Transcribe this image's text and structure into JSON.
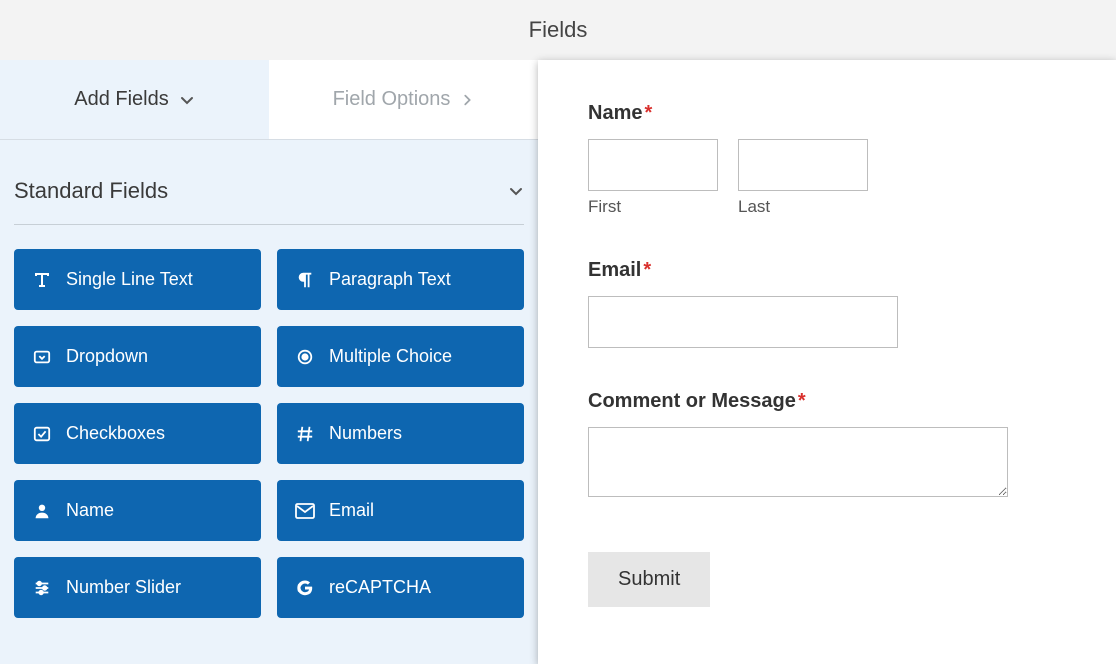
{
  "header": {
    "title": "Fields"
  },
  "tabs": {
    "add": "Add Fields",
    "options": "Field Options"
  },
  "section": {
    "title": "Standard Fields",
    "fields": [
      {
        "label": "Single Line Text",
        "icon": "text"
      },
      {
        "label": "Paragraph Text",
        "icon": "paragraph"
      },
      {
        "label": "Dropdown",
        "icon": "dropdown"
      },
      {
        "label": "Multiple Choice",
        "icon": "radio"
      },
      {
        "label": "Checkboxes",
        "icon": "check"
      },
      {
        "label": "Numbers",
        "icon": "hash"
      },
      {
        "label": "Name",
        "icon": "user"
      },
      {
        "label": "Email",
        "icon": "envelope"
      },
      {
        "label": "Number Slider",
        "icon": "sliders"
      },
      {
        "label": "reCAPTCHA",
        "icon": "google"
      }
    ]
  },
  "form": {
    "name_label": "Name",
    "first_sublabel": "First",
    "last_sublabel": "Last",
    "email_label": "Email",
    "comment_label": "Comment or Message",
    "submit_label": "Submit",
    "required_mark": "*"
  }
}
